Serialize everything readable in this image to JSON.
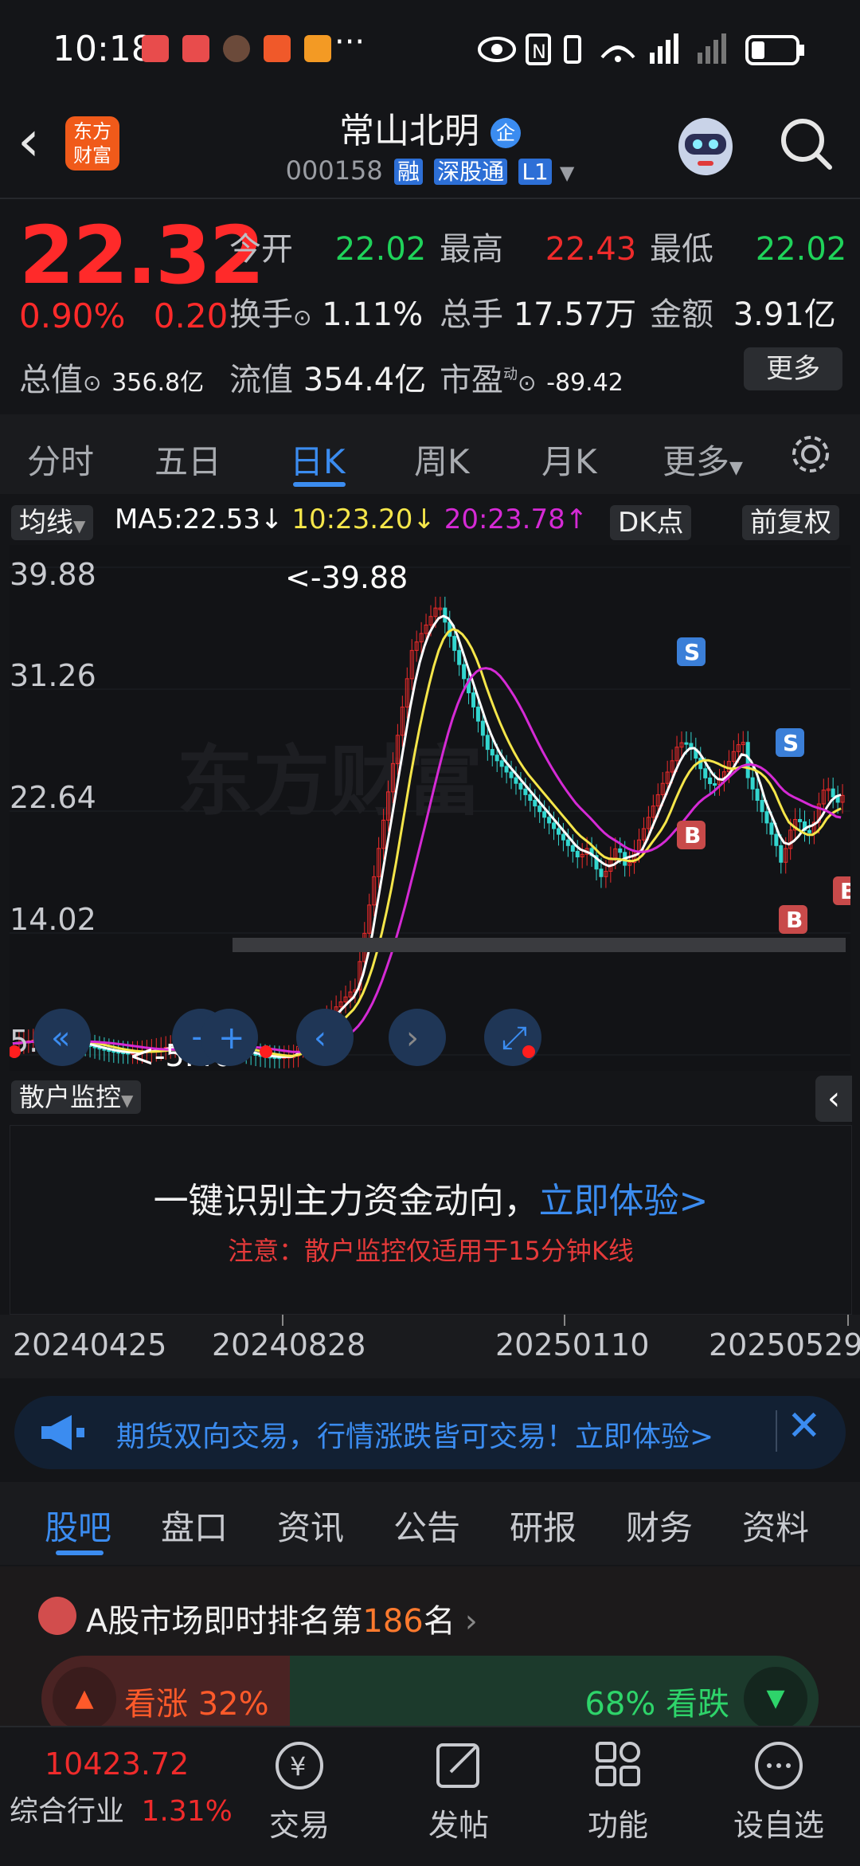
{
  "status_bar": {
    "time": "10:18",
    "dots": "···"
  },
  "header": {
    "logo_text_line1": "东方",
    "logo_text_line2": "财富",
    "stock_name": "常山北明",
    "badge": "企",
    "code": "000158",
    "tag1": "融",
    "tag2": "深股通",
    "tag3": "L1"
  },
  "quote": {
    "price": "22.32",
    "change_pct": "0.90%",
    "change": "0.20",
    "open_label": "今开",
    "open": "22.02",
    "high_label": "最高",
    "high": "22.43",
    "low_label": "最低",
    "low": "22.02",
    "turnover_label": "换手",
    "turnover": "1.11%",
    "volume_label": "总手",
    "volume": "17.57万",
    "amount_label": "金额",
    "amount": "3.91亿",
    "total_value_label": "总值",
    "total_value": "356.8亿",
    "float_value_label": "流值",
    "float_value": "354.4亿",
    "pe_label": "市盈",
    "pe_super": "动",
    "pe": "-89.42",
    "more_label": "更多"
  },
  "chart_tabs": [
    {
      "label": "分时"
    },
    {
      "label": "五日"
    },
    {
      "label": "日K"
    },
    {
      "label": "周K"
    },
    {
      "label": "月K"
    },
    {
      "label": "更多"
    }
  ],
  "ma_bar": {
    "indicator": "均线",
    "ma5": "MA5:22.53↓",
    "ma10": "10:23.20↓",
    "ma20": "20:23.78↑",
    "dk": "DK点",
    "adjust": "前复权"
  },
  "kline": {
    "y_labels": [
      "39.88",
      "31.26",
      "22.64",
      "14.02",
      "5.40"
    ],
    "max_note": "<-39.88",
    "min_note": "<-5.40",
    "marker_s": "S",
    "marker_b": "B",
    "watermark": "东方财富",
    "colors": {
      "ma5": "#ffffff",
      "ma10": "#f5e64a",
      "ma20": "#d52ad5",
      "up": "#ef2b2b",
      "down": "#33d6cf"
    }
  },
  "monitor": {
    "dropdown": "散户监控",
    "headline": "一键识别主力资金动向，",
    "cta": "立即体验>",
    "note": "注意：散户监控仅适用于15分钟K线"
  },
  "dates": [
    "20240425",
    "20240828",
    "20250110",
    "20250529"
  ],
  "banner": {
    "text": "期货双向交易，行情涨跌皆可交易！立即体验>"
  },
  "section_tabs": [
    "股吧",
    "盘口",
    "资讯",
    "公告",
    "研报",
    "财务",
    "资料"
  ],
  "rank": {
    "prefix": "A股市场即时排名第",
    "number": "186",
    "suffix": "名",
    "bull_label": "看涨 32%",
    "bear_label": "68% 看跌",
    "bull_fraction": 0.32
  },
  "bottom_nav": {
    "index_value": "10423.72",
    "index_label": "综合行业",
    "index_change": "1.31%",
    "items": [
      "交易",
      "发帖",
      "功能",
      "设自选"
    ]
  }
}
